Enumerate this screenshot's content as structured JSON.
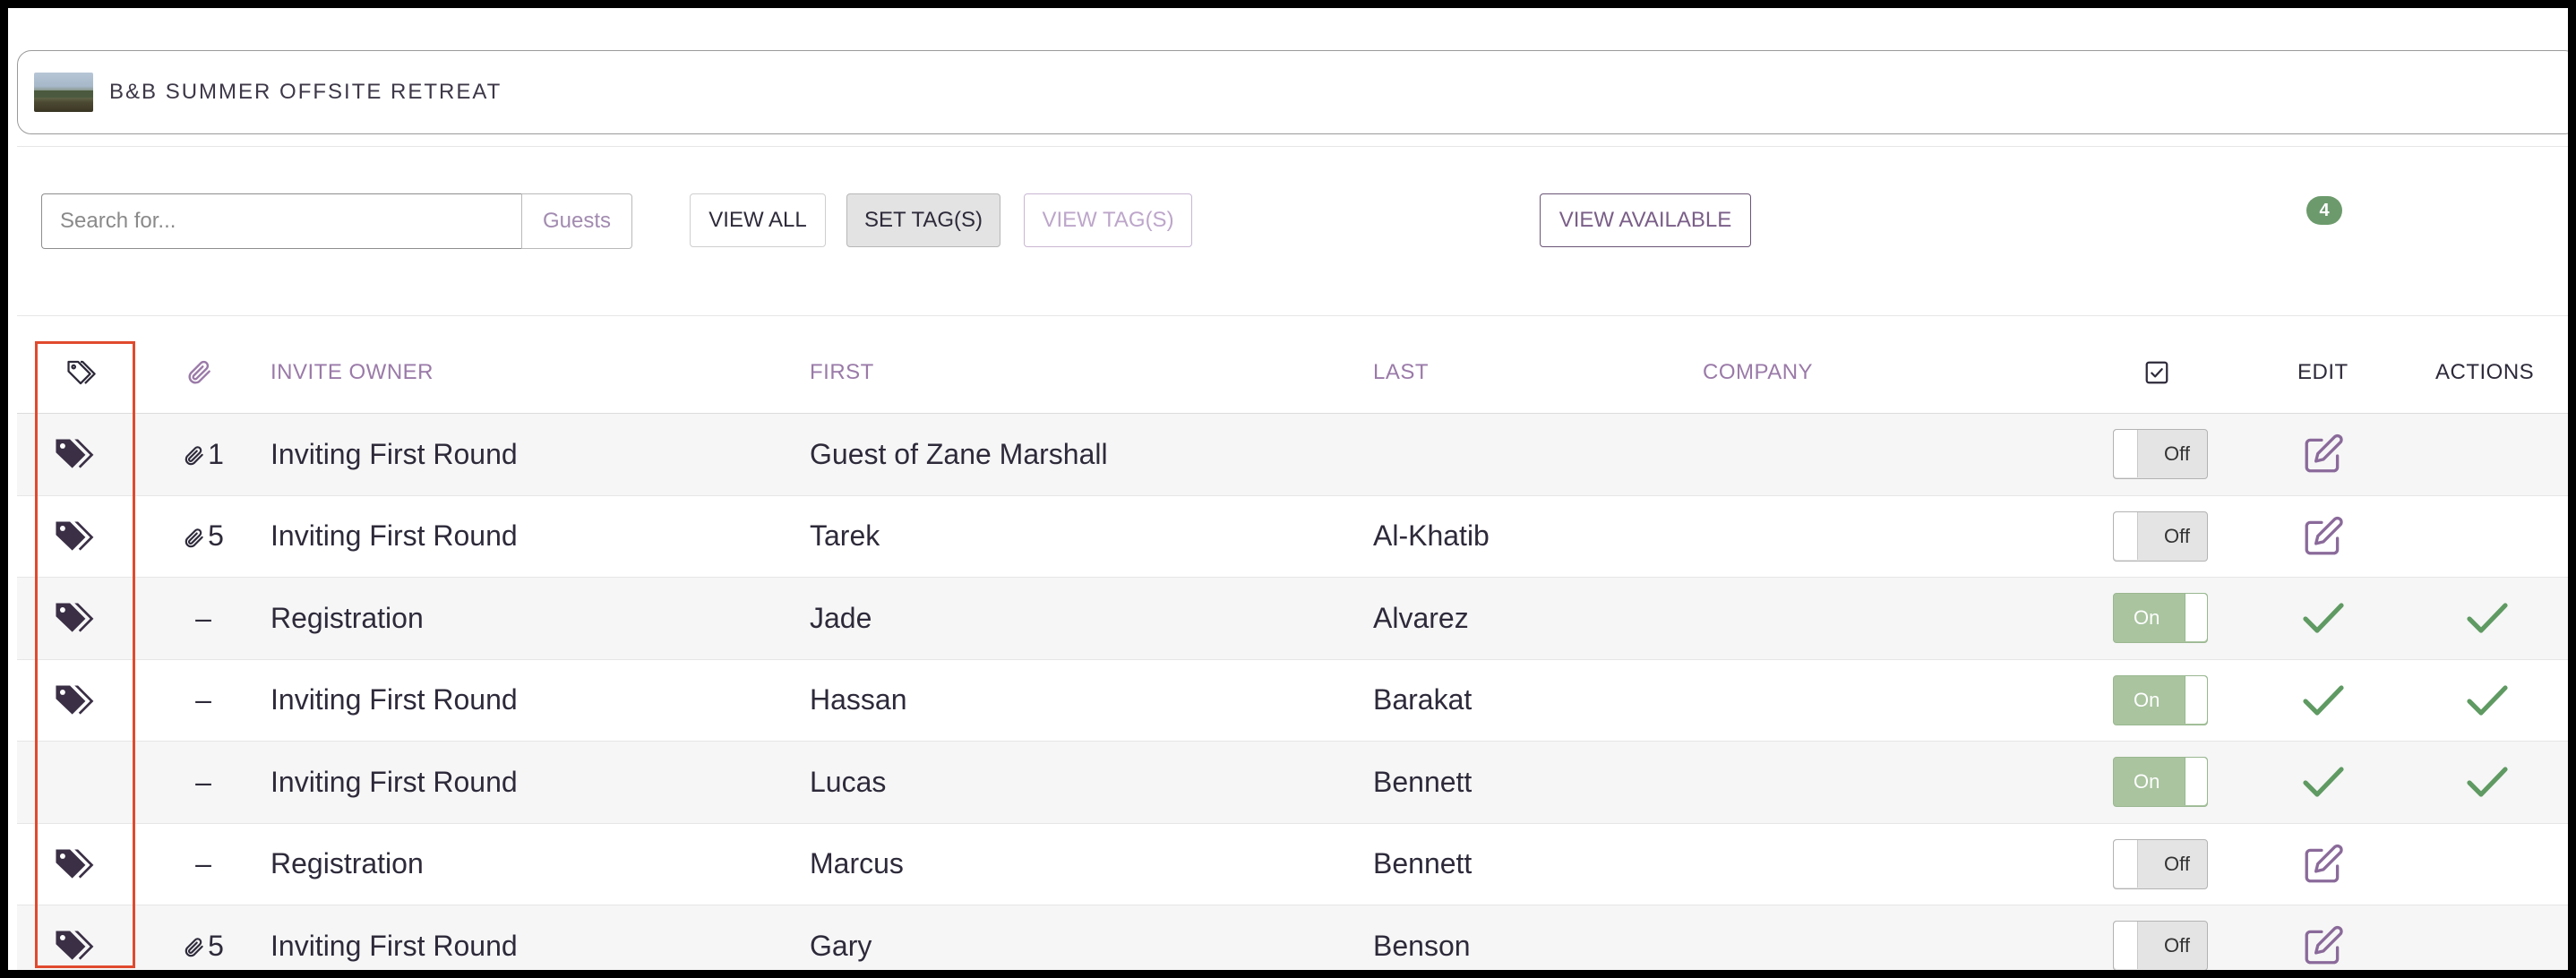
{
  "event": {
    "title": "B&B SUMMER OFFSITE RETREAT"
  },
  "toolbar": {
    "search_placeholder": "Search for...",
    "search_scope": "Guests",
    "view_all": "VIEW ALL",
    "set_tags": "SET TAG(S)",
    "view_tags": "VIEW TAG(S)",
    "view_available": "VIEW AVAILABLE",
    "count": "4"
  },
  "table": {
    "headers": {
      "invite_owner": "INVITE OWNER",
      "first": "FIRST",
      "last": "LAST",
      "company": "COMPANY",
      "edit": "EDIT",
      "actions": "ACTIONS"
    },
    "rows": [
      {
        "tagged": true,
        "attachment": "1",
        "owner": "Inviting First Round",
        "first": "Guest of Zane Marshall",
        "last": "",
        "company": "",
        "toggle": "Off",
        "edit": "edit-icon",
        "action": ""
      },
      {
        "tagged": true,
        "attachment": "5",
        "owner": "Inviting First Round",
        "first": "Tarek",
        "last": "Al-Khatib",
        "company": "",
        "toggle": "Off",
        "edit": "edit-icon",
        "action": ""
      },
      {
        "tagged": true,
        "attachment": "–",
        "owner": "Registration",
        "first": "Jade",
        "last": "Alvarez",
        "company": "",
        "toggle": "On",
        "edit": "check-icon",
        "action": "check-icon"
      },
      {
        "tagged": true,
        "attachment": "–",
        "owner": "Inviting First Round",
        "first": "Hassan",
        "last": "Barakat",
        "company": "",
        "toggle": "On",
        "edit": "check-icon",
        "action": "check-icon"
      },
      {
        "tagged": false,
        "attachment": "–",
        "owner": "Inviting First Round",
        "first": "Lucas",
        "last": "Bennett",
        "company": "",
        "toggle": "On",
        "edit": "check-icon",
        "action": "check-icon"
      },
      {
        "tagged": true,
        "attachment": "–",
        "owner": "Registration",
        "first": "Marcus",
        "last": "Bennett",
        "company": "",
        "toggle": "Off",
        "edit": "edit-icon",
        "action": ""
      },
      {
        "tagged": true,
        "attachment": "5",
        "owner": "Inviting First Round",
        "first": "Gary",
        "last": "Benson",
        "company": "",
        "toggle": "Off",
        "edit": "edit-icon",
        "action": ""
      }
    ]
  },
  "colors": {
    "accent_purple": "#9a7aa8",
    "check_green": "#5f9a62",
    "toggle_on": "#a9c49f",
    "highlight": "#e04a2e"
  }
}
